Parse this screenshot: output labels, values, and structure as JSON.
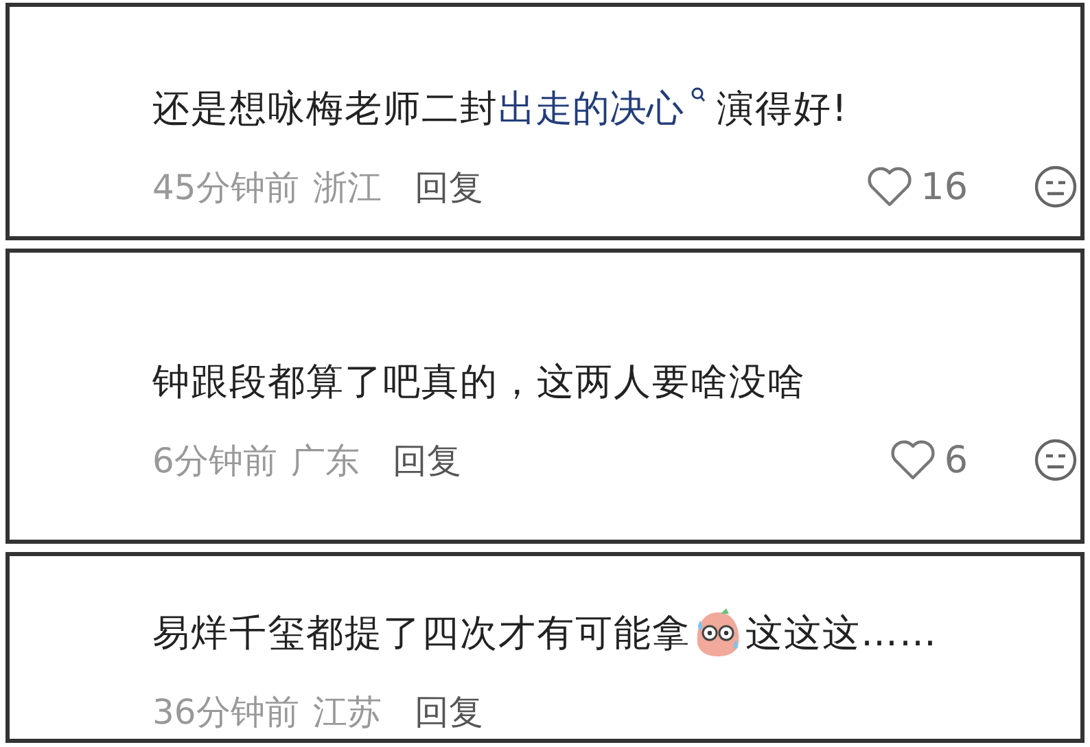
{
  "comments": [
    {
      "content": [
        {
          "kind": "text",
          "text": "还是想咏梅老师二封 "
        },
        {
          "kind": "topic",
          "text": "出走的决心"
        },
        {
          "kind": "text",
          "text": "演得好!"
        }
      ],
      "time": "45分钟前",
      "location": "浙江",
      "reply": "回复",
      "likes": "16"
    },
    {
      "content": [
        {
          "kind": "text",
          "text": "钟跟段都算了吧真的，这两人要啥没啥"
        }
      ],
      "time": "6分钟前",
      "location": "广东",
      "reply": "回复",
      "likes": "6"
    },
    {
      "content": [
        {
          "kind": "text",
          "text": "易烊千玺都提了四次才有可能拿"
        },
        {
          "kind": "emoji"
        },
        {
          "kind": "text",
          "text": "这这这……"
        }
      ],
      "time": "36分钟前",
      "location": "江苏",
      "reply": "回复"
    }
  ]
}
